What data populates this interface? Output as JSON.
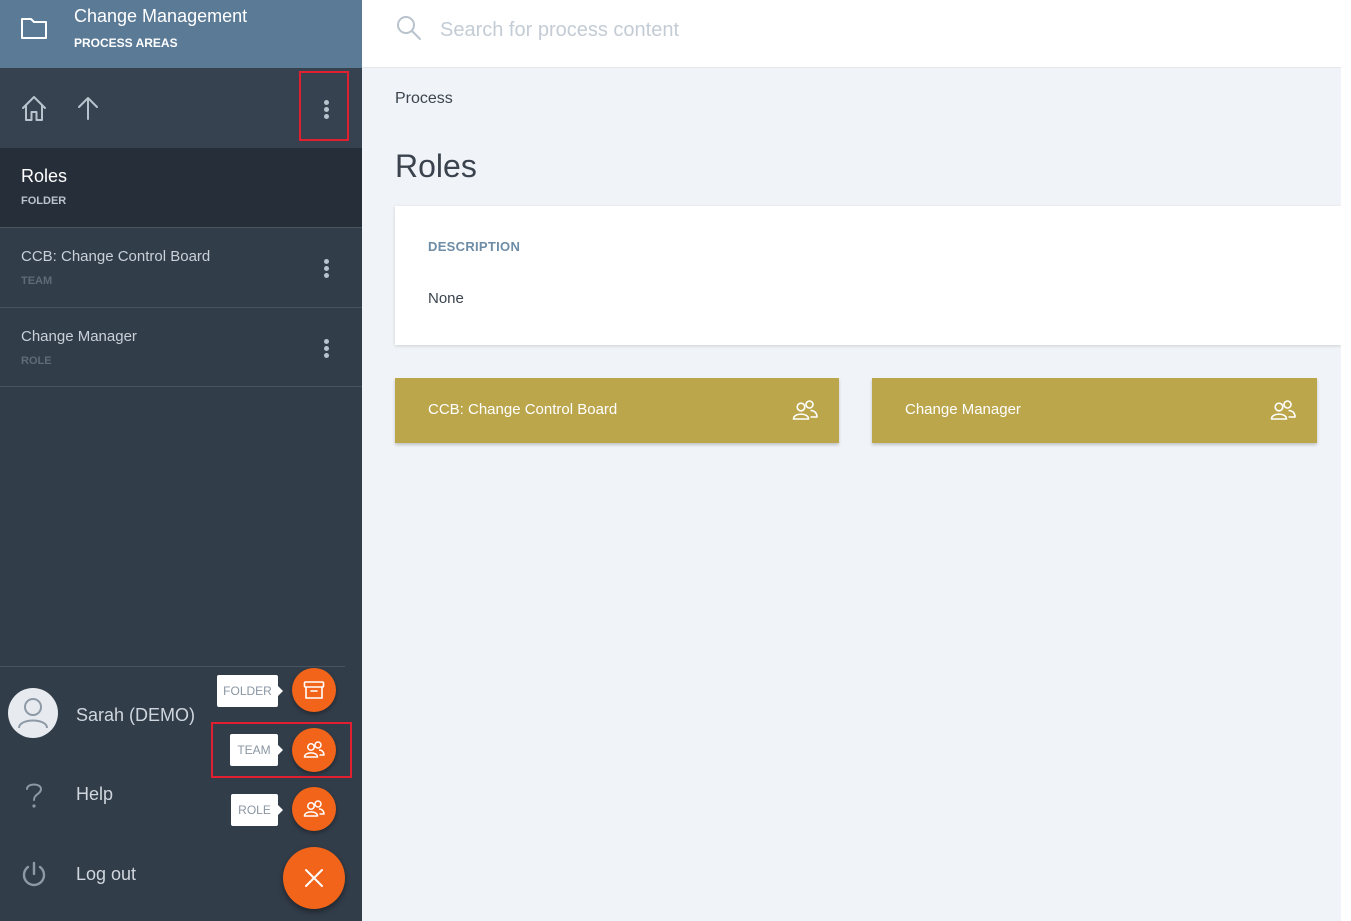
{
  "sidebar": {
    "header": {
      "title": "Change Management",
      "subtitle": "PROCESS AREAS"
    },
    "current": {
      "title": "Roles",
      "type": "FOLDER"
    },
    "items": [
      {
        "title": "CCB: Change Control Board",
        "type": "TEAM"
      },
      {
        "title": "Change Manager",
        "type": "ROLE"
      }
    ],
    "user": {
      "name": "Sarah (DEMO)"
    },
    "help_label": "Help",
    "logout_label": "Log out"
  },
  "speed_dial": {
    "folder_label": "FOLDER",
    "team_label": "TEAM",
    "role_label": "ROLE"
  },
  "search": {
    "placeholder": "Search for process content"
  },
  "main": {
    "breadcrumb": "Process",
    "title": "Roles",
    "description": {
      "label": "DESCRIPTION",
      "value": "None"
    },
    "tiles": [
      {
        "label": "CCB: Change Control Board",
        "icon": "team-icon"
      },
      {
        "label": "Change Manager",
        "icon": "team-icon"
      }
    ]
  },
  "colors": {
    "sidebar_bg": "#323d4a",
    "header_bg": "#5b7a96",
    "accent_orange": "#f26419",
    "tile_gold": "#bba64c",
    "highlight_red": "#e02030",
    "content_bg": "#f0f3f7"
  }
}
